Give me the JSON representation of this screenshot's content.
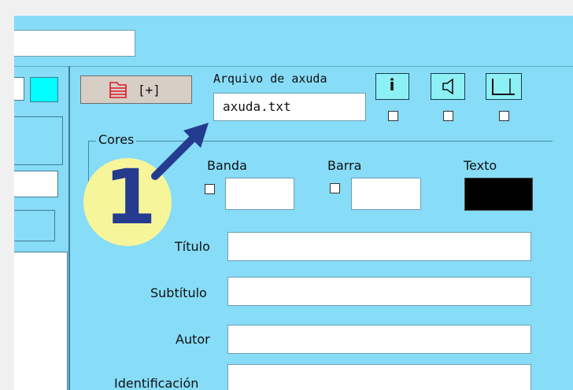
{
  "help": {
    "label": "Arquivo de axuda",
    "file_value": "axuda.txt",
    "add_button_label": "[+]"
  },
  "colors": {
    "group_label": "Cores",
    "band_label": "Banda",
    "bar_label": "Barra",
    "text_label": "Texto",
    "text_color": "#000000"
  },
  "form": {
    "title_label": "Título",
    "subtitle_label": "Subtítulo",
    "author_label": "Autor",
    "id_label": "Identificación"
  },
  "annotation": {
    "step_number": "1",
    "badge_color": "#f7f59a",
    "arrow_color": "#243b8f"
  },
  "icons": {
    "folder_icon": "folder-icon",
    "info_icon": "info-icon",
    "speaker_icon": "speaker-icon",
    "window_icon": "window-icon"
  }
}
